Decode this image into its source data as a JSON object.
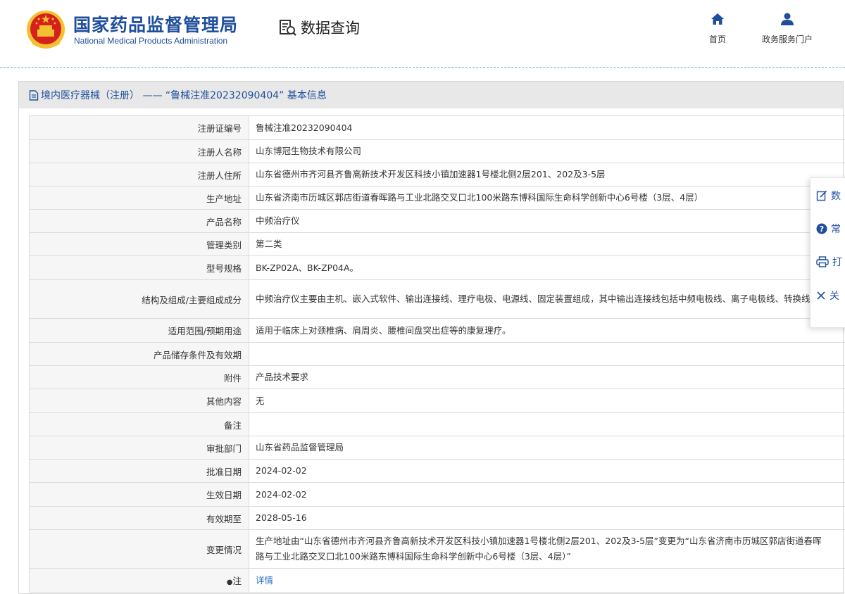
{
  "header": {
    "brand_cn": "国家药品监督管理局",
    "brand_en": "National Medical Products Administration",
    "query_label": "数据查询",
    "nav": [
      {
        "label": "首页",
        "icon": "home-icon"
      },
      {
        "label": "政务服务门户",
        "icon": "user-icon"
      }
    ]
  },
  "panel": {
    "title": "境内医疗器械（注册） —— “鲁械注准20232090404” 基本信息",
    "rows": [
      {
        "key": "注册证编号",
        "value": "鲁械注准20232090404"
      },
      {
        "key": "注册人名称",
        "value": "山东博冠生物技术有限公司"
      },
      {
        "key": "注册人住所",
        "value": "山东省德州市齐河县齐鲁高新技术开发区科技小镇加速器1号楼北侧2层201、202及3-5层"
      },
      {
        "key": "生产地址",
        "value": "山东省济南市历城区郭店街道春晖路与工业北路交叉口北100米路东博科国际生命科学创新中心6号楼（3层、4层）"
      },
      {
        "key": "产品名称",
        "value": "中频治疗仪"
      },
      {
        "key": "管理类别",
        "value": "第二类"
      },
      {
        "key": "型号规格",
        "value": "BK-ZP02A、BK-ZP04A。"
      },
      {
        "key": "结构及组成/主要组成成分",
        "value": "中频治疗仪主要由主机、嵌入式软件、输出连接线、理疗电极、电源线、固定装置组成，其中输出连接线包括中频电极线、离子电极线、转换线。"
      },
      {
        "key": "适用范围/预期用途",
        "value": "适用于临床上对颈椎病、肩周炎、腰椎间盘突出症等的康复理疗。"
      },
      {
        "key": "产品储存条件及有效期",
        "value": ""
      },
      {
        "key": "附件",
        "value": "产品技术要求"
      },
      {
        "key": "其他内容",
        "value": "无"
      },
      {
        "key": "备注",
        "value": ""
      },
      {
        "key": "审批部门",
        "value": "山东省药品监督管理局"
      },
      {
        "key": "批准日期",
        "value": "2024-02-02"
      },
      {
        "key": "生效日期",
        "value": "2024-02-02"
      },
      {
        "key": "有效期至",
        "value": "2028-05-16"
      },
      {
        "key": "变更情况",
        "value": "生产地址由“山东省德州市齐河县齐鲁高新技术开发区科技小镇加速器1号楼北侧2层201、202及3-5层”变更为“山东省济南市历城区郭店街道春晖路与工业北路交叉口北100米路东博科国际生命科学创新中心6号楼（3层、4层）”"
      },
      {
        "key": "注",
        "value": "详情"
      }
    ]
  },
  "sidebar": {
    "items": [
      {
        "label": "数",
        "icon": "edit-icon"
      },
      {
        "label": "常",
        "icon": "help-icon"
      },
      {
        "label": "打",
        "icon": "print-icon"
      },
      {
        "label": "关",
        "icon": "close-icon"
      }
    ]
  },
  "colors": {
    "brand": "#1f4f9c",
    "link": "#1f6fc4",
    "title_bar": "#e8e8e8",
    "key_cell": "#f6f6f6"
  }
}
